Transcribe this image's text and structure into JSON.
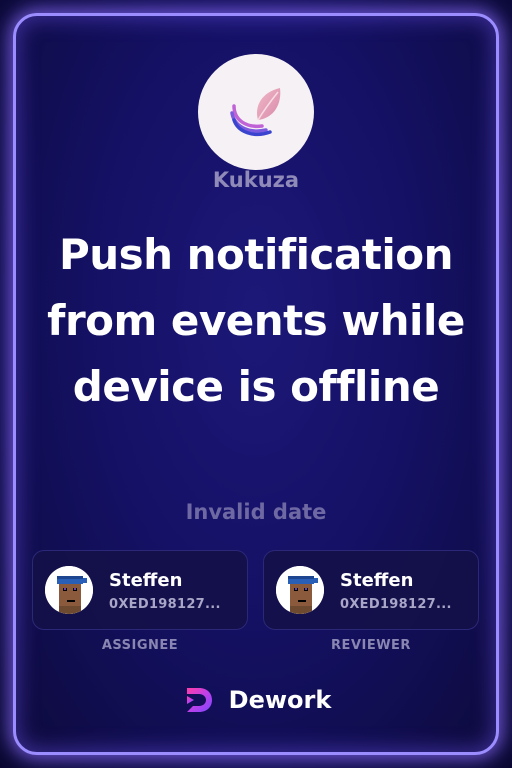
{
  "project": {
    "name": "Kukuza",
    "logo_icon": "leaf-logo-icon"
  },
  "task": {
    "title": "Push notification from events while device is offline",
    "date": "Invalid date"
  },
  "assignee": {
    "name": "Steffen",
    "address": "0XED198127...",
    "role_label": "ASSIGNEE"
  },
  "reviewer": {
    "name": "Steffen",
    "address": "0XED198127...",
    "role_label": "REVIEWER"
  },
  "brand": {
    "name": "Dework",
    "logo_icon": "dework-logo-icon"
  },
  "colors": {
    "background": "#151166",
    "border_glow": "#9b8cff",
    "muted_text": "#8f8ab8",
    "title_text": "#ffffff"
  }
}
